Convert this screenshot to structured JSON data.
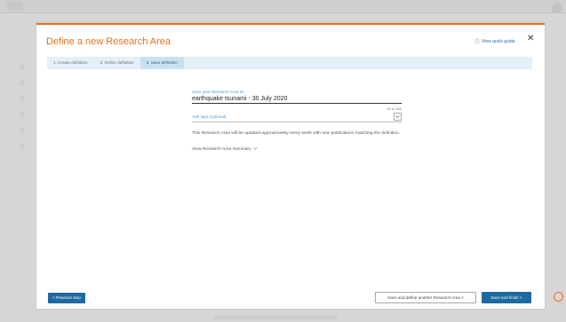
{
  "modal": {
    "title": "Define a new Research Area",
    "quick_guide_label": "View quick guide",
    "close_symbol": "✕"
  },
  "steps": [
    {
      "label": "1. Create definition",
      "active": false
    },
    {
      "label": "2. Refine definition",
      "active": false
    },
    {
      "label": "3. Save definition",
      "active": true
    }
  ],
  "form": {
    "name_label": "Save your Research Area as",
    "name_value": "earthquake tsunami - 30 July 2020",
    "char_count": "33 of 300",
    "tags_placeholder": "Add tags (optional)",
    "info_text": "This Research Area will be updated approximately every week with new publications matching the definition.",
    "summary_link": "View Research Area Summary"
  },
  "footer": {
    "previous_label": "< Previous step",
    "save_another_label": "Save and define another Research Area  >",
    "save_finish_label": "Save and finish  >"
  },
  "colors": {
    "accent": "#e9711c",
    "primary_button": "#1e6a9e",
    "link": "#4a9ccc",
    "stepbar": "#e3f0f7"
  }
}
